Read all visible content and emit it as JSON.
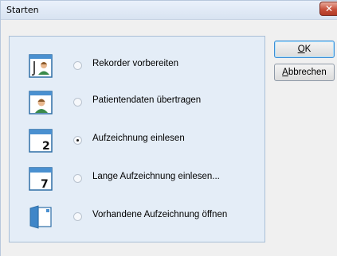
{
  "window": {
    "title": "Starten",
    "close_glyph": "✕"
  },
  "buttons": {
    "ok": {
      "mnemonic": "O",
      "rest": "K"
    },
    "cancel": {
      "mnemonic": "A",
      "rest": "bbrechen"
    }
  },
  "options": [
    {
      "label": "Rekorder vorbereiten",
      "icon": "recorder-icon",
      "checked": false
    },
    {
      "label": "Patientendaten übertragen",
      "icon": "patient-data-icon",
      "checked": false
    },
    {
      "label": "Aufzeichnung einlesen",
      "icon": "calendar-2-icon",
      "icon_text": "2",
      "checked": true
    },
    {
      "label": "Lange Aufzeichnung einlesen...",
      "icon": "calendar-7-icon",
      "icon_text": "7",
      "checked": false
    },
    {
      "label": "Vorhandene Aufzeichnung öffnen",
      "icon": "open-file-icon",
      "checked": false
    }
  ],
  "colors": {
    "accent": "#3d8ed6",
    "group_bg": "#e4edf7",
    "dialog_bg": "#f0f0f0"
  }
}
